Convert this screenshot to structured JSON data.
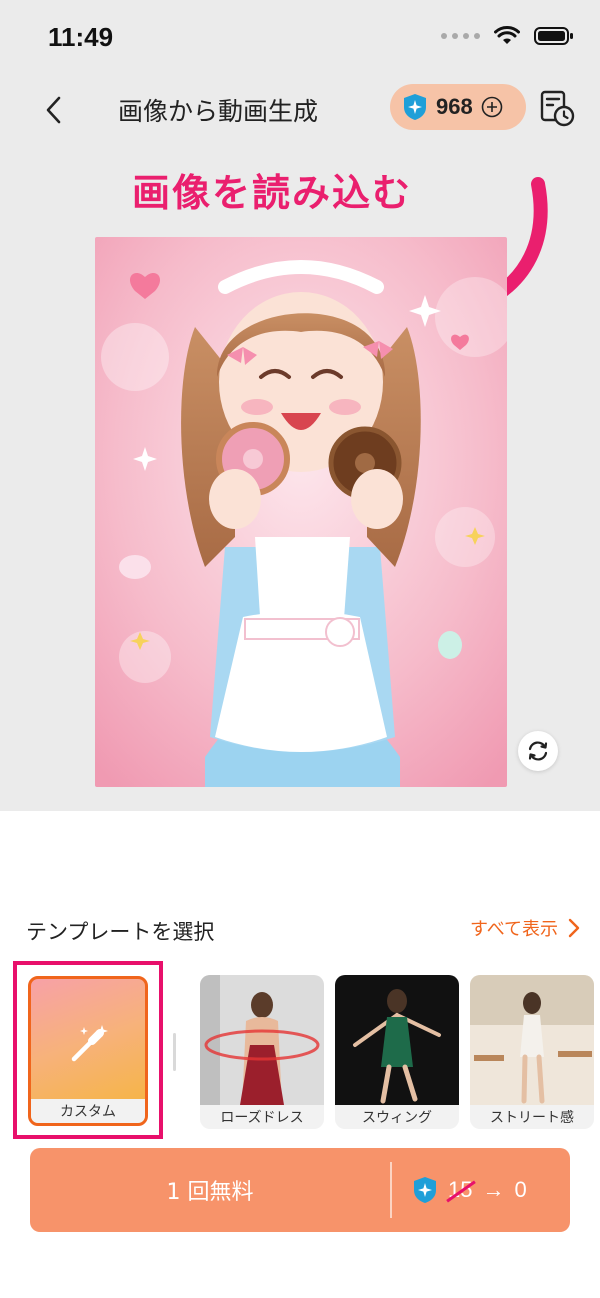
{
  "status": {
    "time": "11:49"
  },
  "header": {
    "title": "画像から動画生成",
    "credits": "968"
  },
  "annotation": "画像を読み込む",
  "templates_section": {
    "title": "テンプレートを選択",
    "see_all": "すべて表示",
    "custom_label": "カスタム",
    "items": [
      {
        "label": "ローズドレス"
      },
      {
        "label": "スウィング"
      },
      {
        "label": "ストリート感"
      }
    ]
  },
  "generate": {
    "free_label": "1 回無料",
    "old_cost": "15",
    "arrow": "→",
    "new_cost": "0"
  },
  "colors": {
    "accent": "#f0651c",
    "highlight": "#e8106b",
    "button": "#f7936a",
    "credit_pill": "#f6c3a7"
  }
}
